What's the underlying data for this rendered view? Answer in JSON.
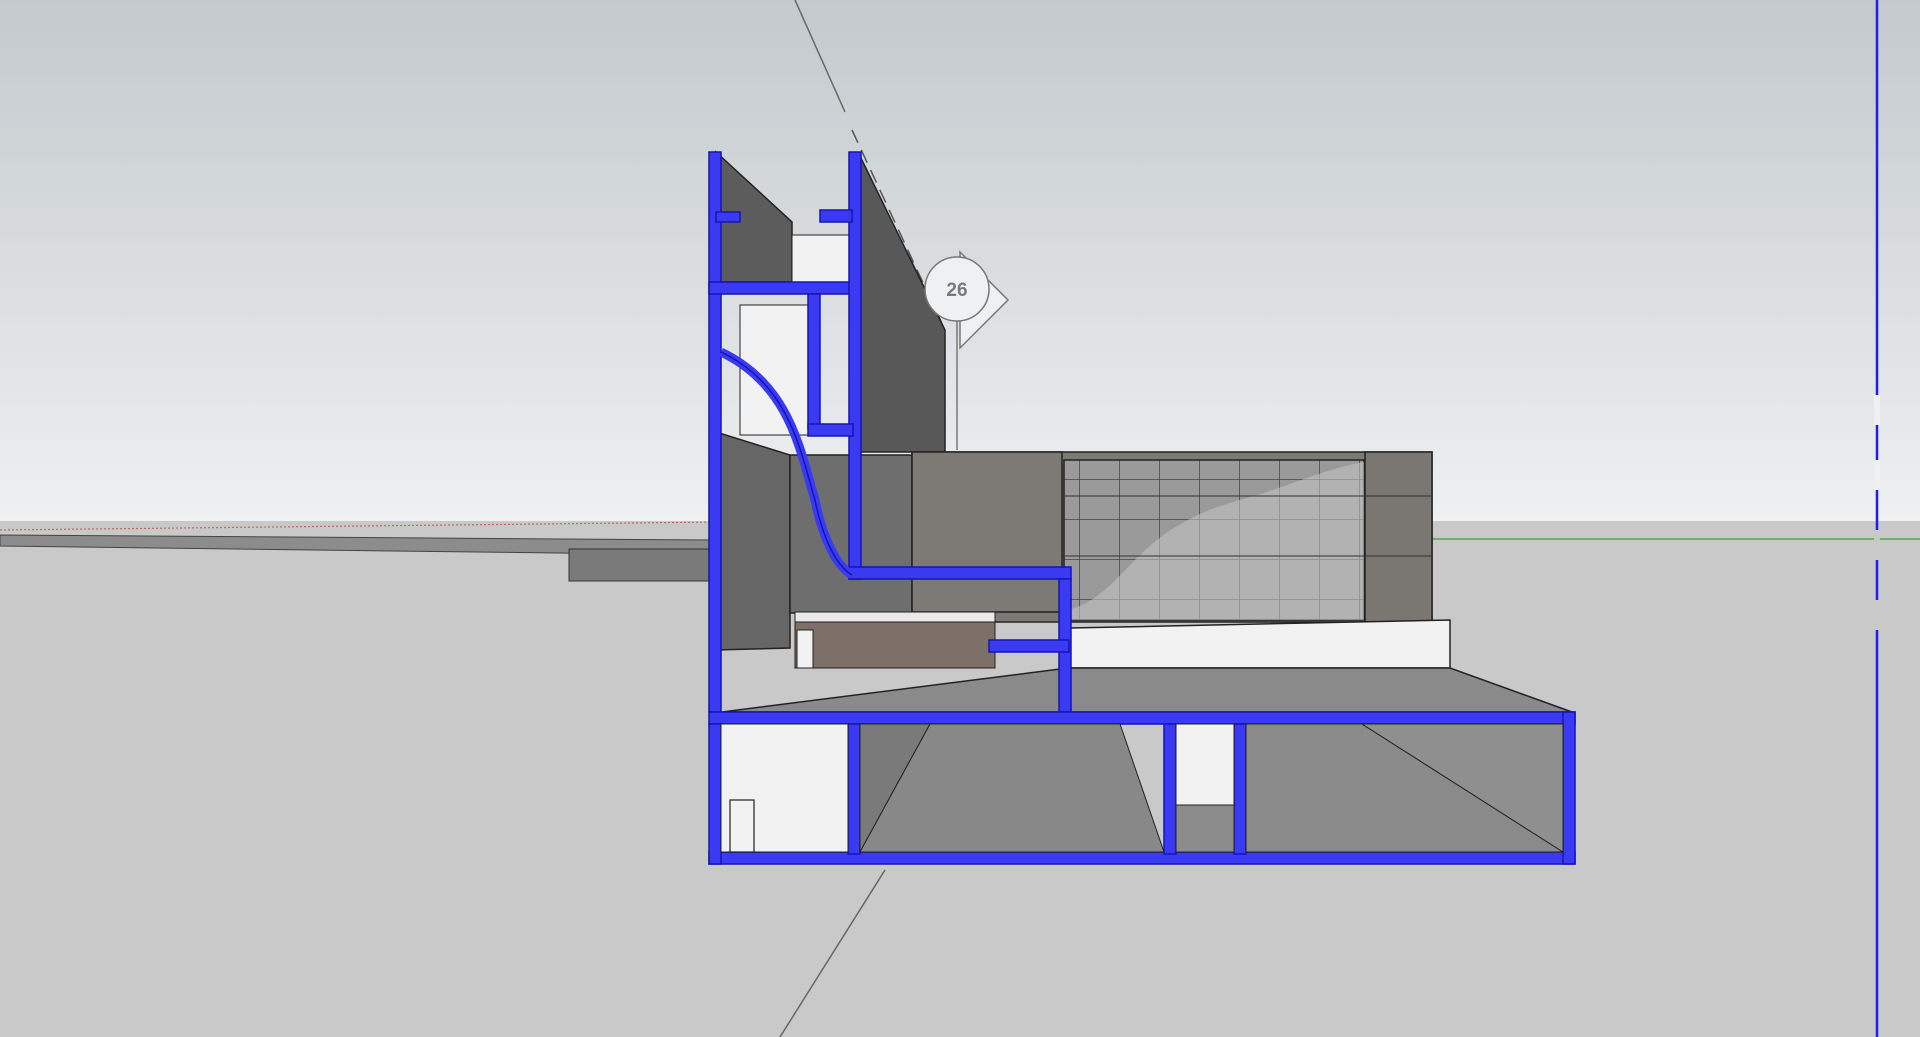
{
  "viewport": {
    "description_free": true,
    "section_plane_label": "26",
    "colors": {
      "sky_top": "#c3c9cd",
      "sky_horizon": "#eef0f1",
      "ground": "#c9c9c9",
      "section_cut": "#3a3af2",
      "section_cut_outline": "#1414b4",
      "wall_dark": "#585858",
      "wall_mid": "#7d7a76",
      "floor_grey": "#8a8a8a",
      "white_surface": "#f2f2f2",
      "green_axis": "#35a135",
      "blue_axis": "#1d1df0",
      "red_axis": "#c0695c"
    }
  }
}
